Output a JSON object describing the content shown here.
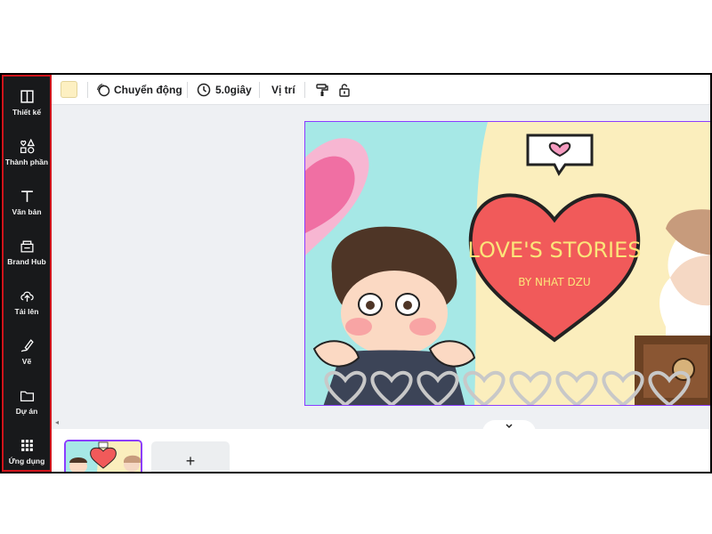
{
  "sidebar": {
    "items": [
      {
        "label": "Thiết kế",
        "icon": "layout-icon"
      },
      {
        "label": "Thành phần",
        "icon": "shapes-icon"
      },
      {
        "label": "Văn bản",
        "icon": "text-icon"
      },
      {
        "label": "Brand Hub",
        "icon": "brand-hub-icon"
      },
      {
        "label": "Tải lên",
        "icon": "upload-icon"
      },
      {
        "label": "Vẽ",
        "icon": "draw-icon"
      },
      {
        "label": "Dự án",
        "icon": "folder-icon"
      },
      {
        "label": "Ứng dụng",
        "icon": "apps-icon"
      }
    ],
    "highlight_color": "#d0141b"
  },
  "toolbar": {
    "background_color": "#fdf0c2",
    "animate_label": "Chuyển động",
    "duration_label": "5.0giây",
    "position_label": "Vị trí"
  },
  "design": {
    "title": "LOVE'S STORIES",
    "subtitle": "BY NHAT DZU",
    "colors": {
      "cream": "#fbeebd",
      "aqua": "#a6e8e6",
      "heart": "#f15a5a",
      "pink": "#f7a8c8"
    }
  },
  "pages": {
    "add_label": "+"
  }
}
